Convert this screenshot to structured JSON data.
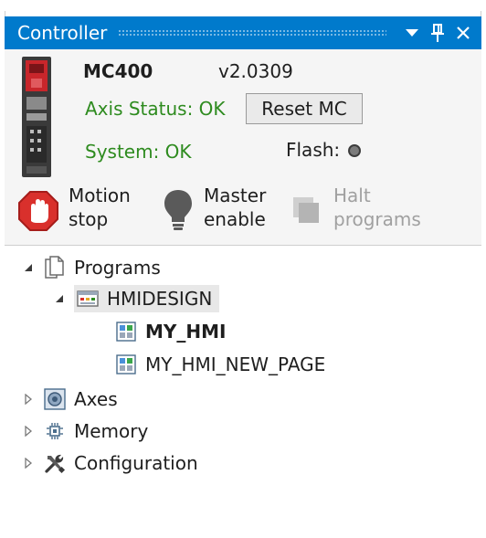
{
  "window": {
    "title": "Controller"
  },
  "controller": {
    "model": "MC400",
    "version": "v2.0309",
    "axis_status": "Axis Status: OK",
    "system_status": "System: OK",
    "flash_label": "Flash:",
    "reset_label": "Reset MC"
  },
  "actions": {
    "motion_stop": [
      "Motion",
      "stop"
    ],
    "master_enable": [
      "Master",
      "enable"
    ],
    "halt_programs": [
      "Halt",
      "programs"
    ]
  },
  "tree": {
    "programs": "Programs",
    "hmidesign": "HMIDESIGN",
    "my_hmi": "MY_HMI",
    "my_hmi_new_page": "MY_HMI_NEW_PAGE",
    "axes": "Axes",
    "memory": "Memory",
    "configuration": "Configuration"
  },
  "colors": {
    "titlebar": "#007acc",
    "status_green": "#2e8b1f",
    "stop_red": "#d9302c",
    "disabled_text": "#a0a0a0"
  },
  "icons": {
    "dropdown": "chevron-down-icon",
    "pin": "pin-icon",
    "close": "close-icon"
  }
}
